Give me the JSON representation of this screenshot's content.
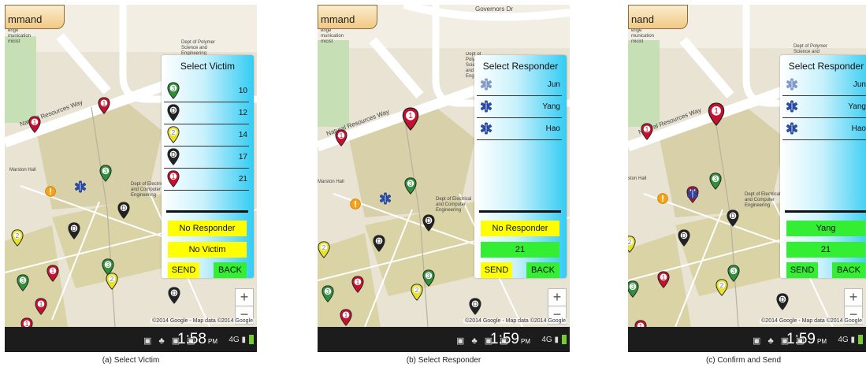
{
  "screens": [
    {
      "app_bar": "mmand",
      "map_labels": {
        "road": "Natural Resources Way",
        "hall": "Marston Hall",
        "poly": "Dept of Polymer Science and Engineering",
        "elec": "Dept of Electrical and Computer Engineering",
        "side": "enge munication micist"
      },
      "panel": {
        "title": "Select Victim",
        "rows": [
          "10",
          "12",
          "14",
          "17",
          "21"
        ],
        "field1": "No Responder",
        "field2": "No Victim",
        "send": "SEND",
        "back": "BACK"
      },
      "status_time": "1:58",
      "status_ampm": "PM",
      "status_net": "4G",
      "caption": "(a) Select Victim"
    },
    {
      "app_bar": "mmand",
      "map_labels": {
        "road": "Natural Resources Way",
        "hall": "Marston Hall",
        "top_road": "Governors Dr",
        "poly": "Dept of Polymer Science and Engineering",
        "elec": "Dept of Electrical and Computer Engineering",
        "side": "enge munication micist"
      },
      "panel": {
        "title": "Select Responder",
        "rows": [
          "Jun",
          "Yang",
          "Hao"
        ],
        "field1": "No Responder",
        "field2": "21",
        "send": "SEND",
        "back": "BACK"
      },
      "status_time": "1:59",
      "status_ampm": "PM",
      "status_net": "4G",
      "caption": "(b) Select Responder"
    },
    {
      "app_bar": "nand",
      "map_labels": {
        "road": "Natural Resources Way",
        "hall": "ston Hall",
        "poly": "Dept of Polymer Science and",
        "elec": "Dept of Electrical and Computer Engineering",
        "side": "enge munication micist"
      },
      "panel": {
        "title": "Select Responder",
        "rows": [
          "Jun",
          "Yang",
          "Hao"
        ],
        "field1": "Yang",
        "field2": "21",
        "send": "SEND",
        "back": "BACK"
      },
      "status_time": "1:59",
      "status_ampm": "PM",
      "status_net": "4G",
      "caption": "(c) Confirm and Send"
    }
  ],
  "map_attribution": "©2014 Google - Map data ©2014 Google",
  "zoom_in": "+",
  "zoom_out": "−",
  "colors": {
    "map_bg": "#e9e3d4",
    "panel_gradient_end": "#33ccf3",
    "button_yellow": "#ffff00",
    "button_green": "#33ee33",
    "status_bar": "#1c1c1c"
  },
  "icons": {
    "victim_levels": [
      "green-3",
      "black-D",
      "yellow-2",
      "black-D",
      "red-1"
    ],
    "responder": "medic-star-of-life-icon",
    "incident": "warning-marker-icon"
  }
}
